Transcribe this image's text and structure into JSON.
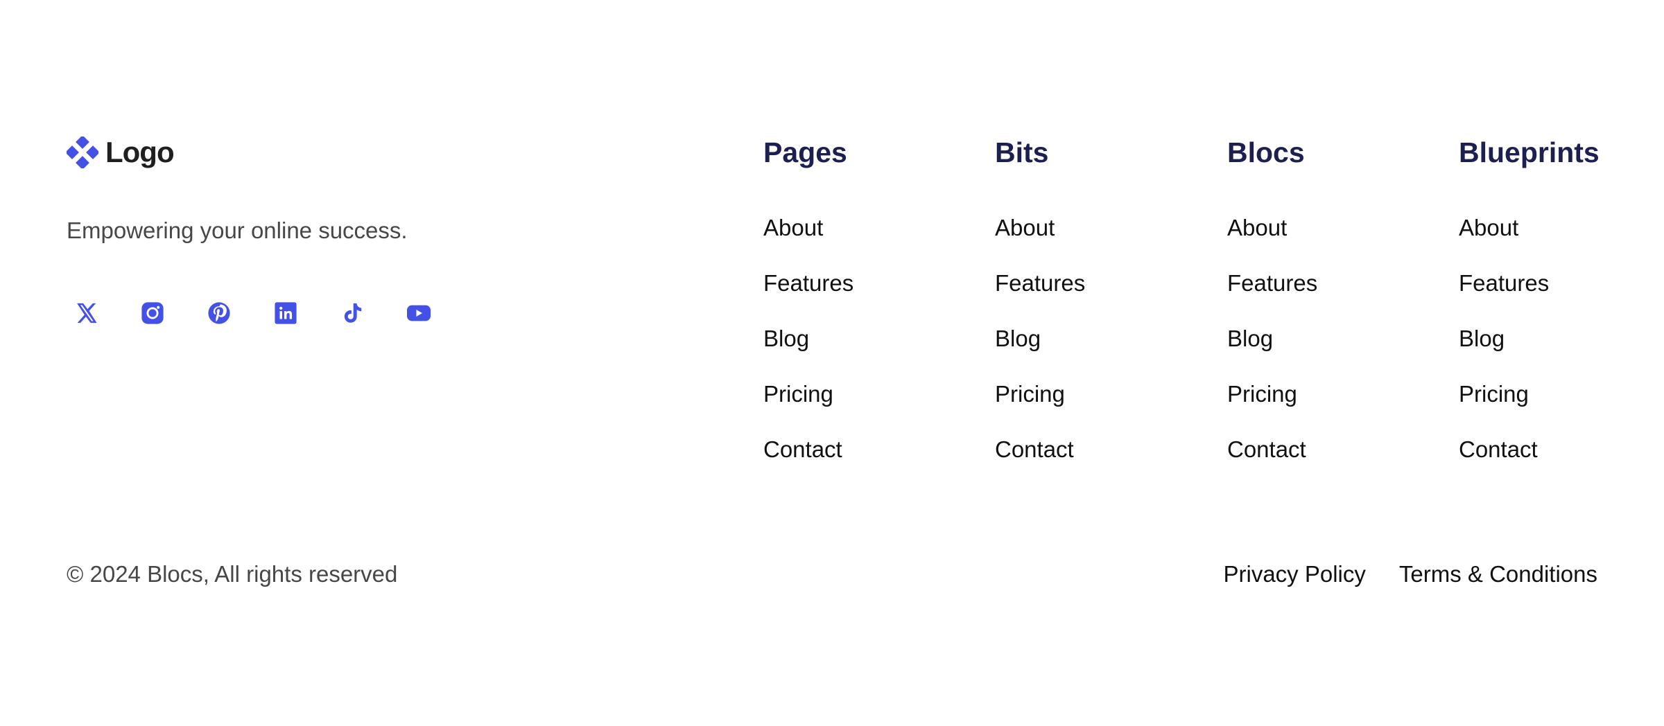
{
  "brand": {
    "logo_text": "Logo",
    "logo_icon": "diamond-cluster-icon",
    "tagline": "Empowering your online success.",
    "accent_color": "#4451e6"
  },
  "socials": [
    {
      "name": "x",
      "icon": "x-icon"
    },
    {
      "name": "instagram",
      "icon": "instagram-icon"
    },
    {
      "name": "pinterest",
      "icon": "pinterest-icon"
    },
    {
      "name": "linkedin",
      "icon": "linkedin-icon"
    },
    {
      "name": "tiktok",
      "icon": "tiktok-icon"
    },
    {
      "name": "youtube",
      "icon": "youtube-icon"
    }
  ],
  "columns": [
    {
      "title": "Pages",
      "links": [
        "About",
        "Features",
        "Blog",
        "Pricing",
        "Contact"
      ]
    },
    {
      "title": "Bits",
      "links": [
        "About",
        "Features",
        "Blog",
        "Pricing",
        "Contact"
      ]
    },
    {
      "title": "Blocs",
      "links": [
        "About",
        "Features",
        "Blog",
        "Pricing",
        "Contact"
      ]
    },
    {
      "title": "Blueprints",
      "links": [
        "About",
        "Features",
        "Blog",
        "Pricing",
        "Contact"
      ]
    }
  ],
  "footer": {
    "copyright": "© 2024 Blocs, All rights reserved",
    "privacy_label": "Privacy Policy",
    "terms_label": "Terms & Conditions"
  }
}
